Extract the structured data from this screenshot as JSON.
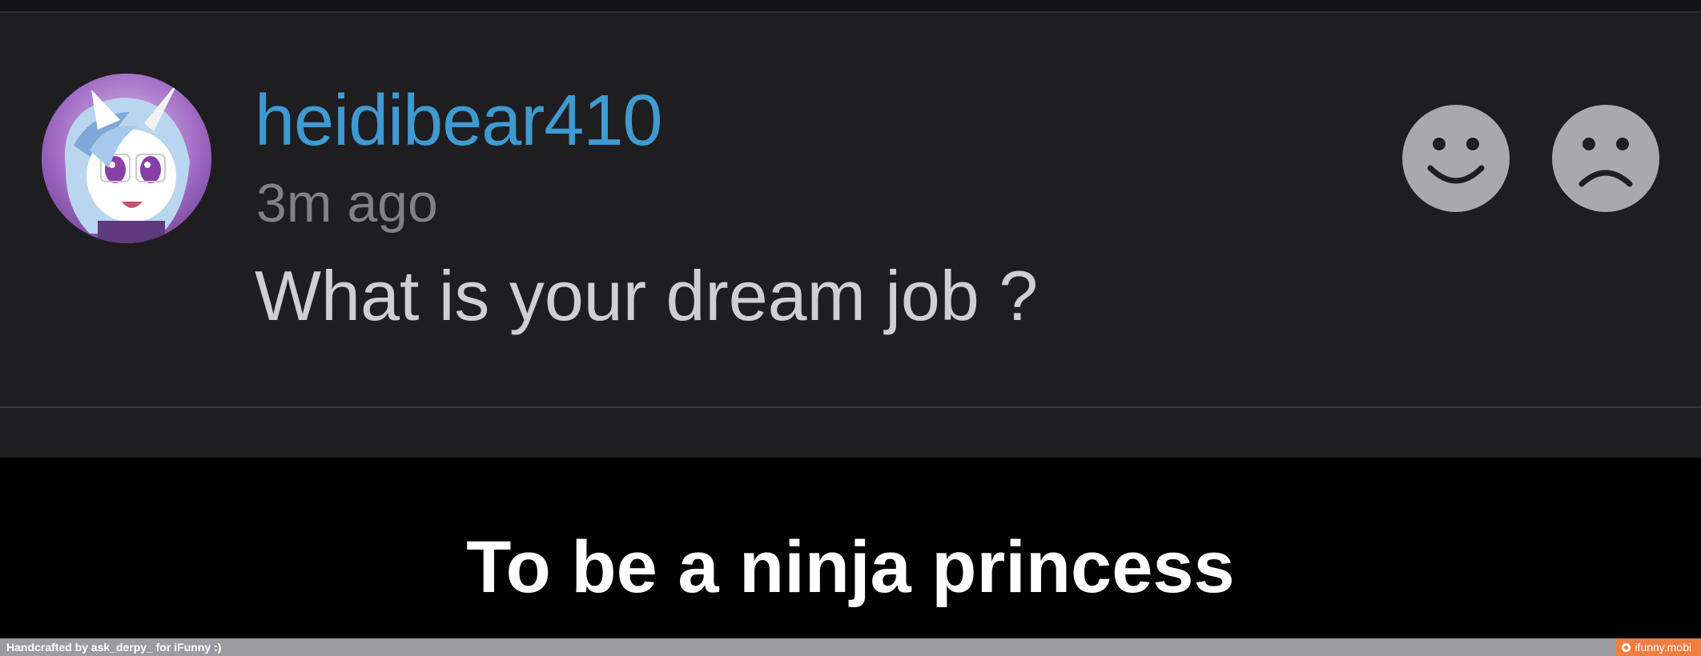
{
  "comment": {
    "username": "heidibear410",
    "timestamp": "3m ago",
    "text": "What is your dream job ?",
    "avatar_icon": "pony-avatar-icon"
  },
  "reactions": {
    "smile_icon": "smile-face-icon",
    "frown_icon": "frown-face-icon"
  },
  "caption": "To be a ninja princess",
  "footer": {
    "credit": "Handcrafted by ask_derpy_ for iFunny :)",
    "watermark": "ifunny.mobi"
  },
  "colors": {
    "username": "#3e9ad0",
    "panel_background": "#1e1e21",
    "reaction_button": "#a9a9ab",
    "watermark_badge": "#f07d41"
  }
}
